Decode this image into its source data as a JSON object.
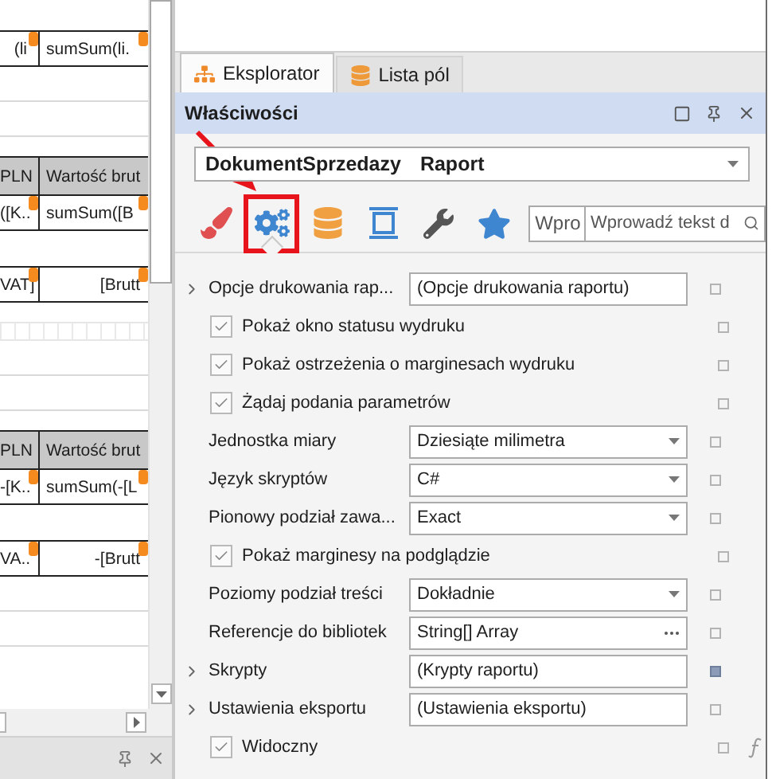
{
  "designer": {
    "bands": [
      {
        "kind": "data",
        "cells": [
          "(li",
          "sumSum(li."
        ]
      },
      {
        "kind": "rule"
      },
      {
        "kind": "rule"
      },
      {
        "kind": "header",
        "cells": [
          "PLN",
          "Wartość brut"
        ]
      },
      {
        "kind": "data",
        "cells": [
          "([K..",
          "sumSum([B"
        ]
      },
      {
        "kind": "total",
        "cells": [
          "VAT]",
          "[Brutt"
        ]
      },
      {
        "kind": "grid"
      },
      {
        "kind": "rule"
      },
      {
        "kind": "rule"
      },
      {
        "kind": "header",
        "cells": [
          "PLN",
          "Wartość brut"
        ]
      },
      {
        "kind": "data",
        "cells": [
          "-[K..",
          "sumSum(-[L"
        ]
      },
      {
        "kind": "total",
        "cells": [
          "VA..",
          "-[Brutt"
        ]
      },
      {
        "kind": "rule"
      },
      {
        "kind": "rule"
      }
    ]
  },
  "tabs": [
    {
      "label": "Eksplorator",
      "kind": "explorer",
      "selected": true
    },
    {
      "label": "Lista pól",
      "kind": "fields",
      "selected": false
    }
  ],
  "panel": {
    "title": "Właściwości"
  },
  "object_selector": {
    "name": "DokumentSprzedazy",
    "type": "Raport"
  },
  "tools": [
    {
      "kind": "brush",
      "selected": false,
      "highlighted": false
    },
    {
      "kind": "gears",
      "selected": true,
      "highlighted": true
    },
    {
      "kind": "database",
      "selected": false,
      "highlighted": false
    },
    {
      "kind": "frame",
      "selected": false,
      "highlighted": false
    },
    {
      "kind": "wrench",
      "selected": false,
      "highlighted": false
    },
    {
      "kind": "star",
      "selected": false,
      "highlighted": false
    }
  ],
  "filter": {
    "value": "Wpro"
  },
  "search": {
    "placeholder": "Wprowadź tekst d"
  },
  "properties": [
    {
      "kind": "group",
      "label": "Opcje drukowania rap...",
      "value": "(Opcje drukowania raportu)",
      "expanded": false,
      "set": false,
      "expression": false
    },
    {
      "kind": "check",
      "label": "Pokaż okno statusu wydruku",
      "checked": true,
      "set": false,
      "expression": false
    },
    {
      "kind": "check",
      "label": "Pokaż ostrzeżenia o marginesach wydruku",
      "checked": true,
      "set": false,
      "expression": false
    },
    {
      "kind": "check",
      "label": "Żądaj podania parametrów",
      "checked": true,
      "set": false,
      "expression": false
    },
    {
      "kind": "dropdown",
      "label": "Jednostka miary",
      "value": "Dziesiąte milimetra",
      "set": false,
      "expression": false
    },
    {
      "kind": "dropdown",
      "label": "Język skryptów",
      "value": "C#",
      "set": false,
      "expression": false
    },
    {
      "kind": "dropdown",
      "label": "Pionowy podział zawa...",
      "value": "Exact",
      "set": false,
      "expression": false
    },
    {
      "kind": "check",
      "label": "Pokaż marginesy na podglądzie",
      "checked": true,
      "set": false,
      "expression": false
    },
    {
      "kind": "dropdown",
      "label": "Poziomy podział treści",
      "value": "Dokładnie",
      "set": false,
      "expression": false
    },
    {
      "kind": "browse",
      "label": "Referencje do bibliotek",
      "value": "String[] Array",
      "set": false,
      "expression": false
    },
    {
      "kind": "group",
      "label": "Skrypty",
      "value": "(Krypty raportu)",
      "expanded": false,
      "set": true,
      "expression": false
    },
    {
      "kind": "group",
      "label": "Ustawienia eksportu",
      "value": "(Ustawienia eksportu)",
      "expanded": false,
      "set": false,
      "expression": false
    },
    {
      "kind": "check",
      "label": "Widoczny",
      "checked": true,
      "set": false,
      "expression": true
    }
  ]
}
